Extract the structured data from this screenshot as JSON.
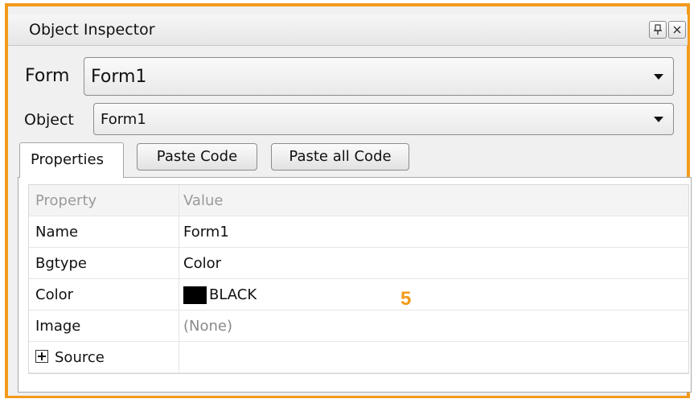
{
  "window": {
    "title": "Object Inspector",
    "pin_icon": "pin-icon",
    "close_icon": "close-icon"
  },
  "form_selector": {
    "label": "Form",
    "value": "Form1"
  },
  "object_selector": {
    "label": "Object",
    "value": "Form1"
  },
  "tabs": {
    "properties_label": "Properties",
    "paste_code_label": "Paste Code",
    "paste_all_code_label": "Paste all Code"
  },
  "grid": {
    "header": {
      "property": "Property",
      "value": "Value"
    },
    "rows": [
      {
        "property": "Name",
        "value": "Form1"
      },
      {
        "property": "Bgtype",
        "value": "Color"
      },
      {
        "property": "Color",
        "value": "BLACK",
        "swatch_color": "#000000"
      },
      {
        "property": "Image",
        "value": "(None)"
      },
      {
        "property": "Source",
        "value": ""
      }
    ]
  },
  "annotation": {
    "label": "5",
    "color": "#f39a1c"
  },
  "colors": {
    "highlight_border": "#f39a1c"
  }
}
